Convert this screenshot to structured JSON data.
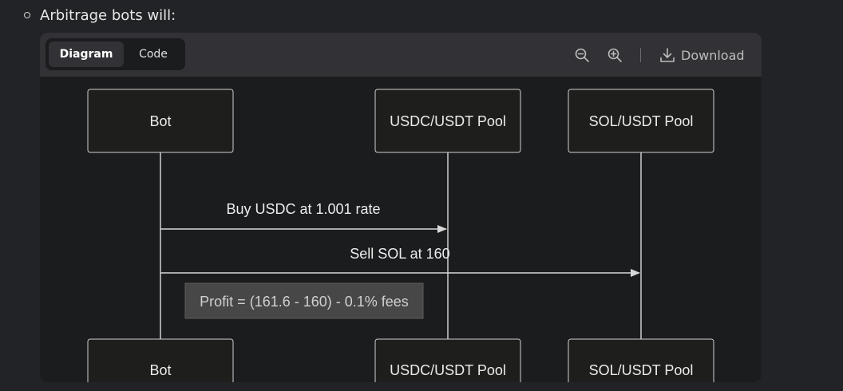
{
  "bullet": {
    "text": "Arbitrage bots will:"
  },
  "toolbar": {
    "tabs": [
      {
        "label": "Diagram",
        "active": true
      },
      {
        "label": "Code",
        "active": false
      }
    ],
    "icons": [
      "zoom-out-icon",
      "zoom-in-icon",
      "download-icon"
    ],
    "download_label": "Download"
  },
  "diagram": {
    "type": "sequence",
    "participants": [
      "Bot",
      "USDC/USDT Pool",
      "SOL/USDT Pool"
    ],
    "messages": [
      {
        "from": "Bot",
        "to": "USDC/USDT Pool",
        "text": "Buy USDC at 1.001 rate"
      },
      {
        "from": "Bot",
        "to": "SOL/USDT Pool",
        "text": "Sell SOL at 160"
      }
    ],
    "note": {
      "text": "Profit = (161.6 - 160) - 0.1% fees"
    }
  },
  "colors": {
    "background": "#222326",
    "panel": "#1b1c1e",
    "toolbar": "#323236",
    "note": "#474747"
  }
}
